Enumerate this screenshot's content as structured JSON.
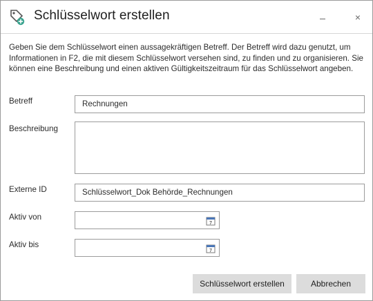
{
  "window": {
    "title": "Schlüsselwort erstellen",
    "icon": "tag-add-icon",
    "minimize_label": "",
    "close_label": "×"
  },
  "intro_text": "Geben Sie dem Schlüsselwort einen aussagekräftigen Betreff. Der Betreff wird dazu genutzt, um Informationen in F2, die mit diesem Schlüsselwort versehen sind, zu finden und zu organisieren. Sie können eine Beschreibung und einen aktiven Gültigkeitszeitraum für das Schlüsselwort angeben.",
  "form": {
    "subject": {
      "label": "Betreff",
      "value": "Rechnungen"
    },
    "description": {
      "label": "Beschreibung",
      "value": ""
    },
    "external_id": {
      "label": "Externe ID",
      "value": "Schlüsselwort_Dok Behörde_Rechnungen"
    },
    "active_from": {
      "label": "Aktiv von",
      "value": "",
      "icon": "calendar-icon"
    },
    "active_until": {
      "label": "Aktiv bis",
      "value": "",
      "icon": "calendar-icon"
    }
  },
  "buttons": {
    "create_label": "Schlüsselwort erstellen",
    "cancel_label": "Abbrechen"
  },
  "colors": {
    "button_bg": "#dcdcdc",
    "field_border": "#9b9b9b",
    "icon_accent": "#3aa38f"
  }
}
